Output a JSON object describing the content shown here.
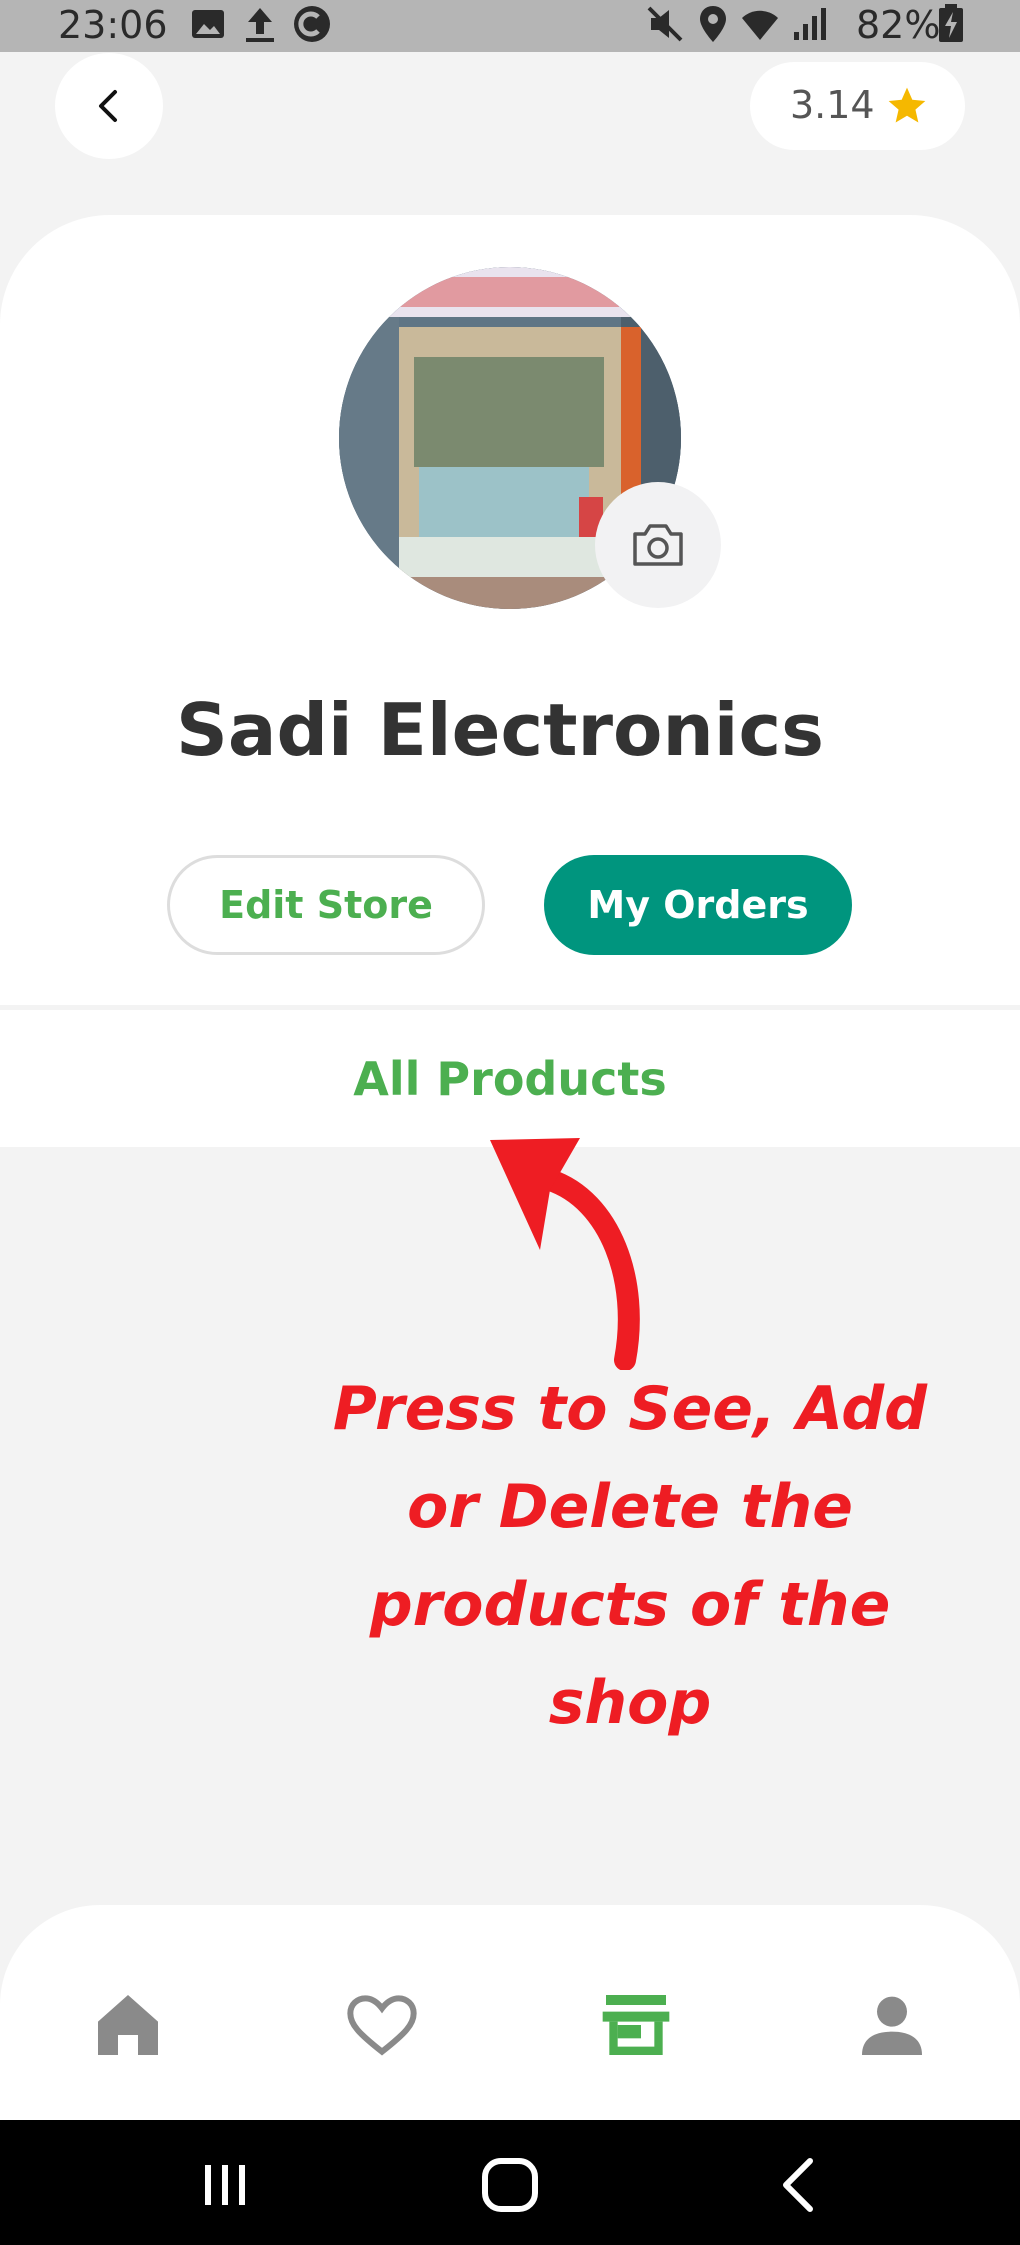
{
  "status_bar": {
    "time": "23:06",
    "battery": "82%",
    "icons": [
      "image-icon",
      "upload-icon",
      "c-app-icon",
      "mute-icon",
      "location-icon",
      "wifi-icon",
      "signal-icon",
      "battery-icon"
    ]
  },
  "header": {
    "back_icon": "chevron-left-icon",
    "rating": "3.14",
    "rating_icon": "star-icon",
    "star_color": "#f5b800"
  },
  "store": {
    "name": "Sadi Electronics",
    "photo_icon": "camera-icon",
    "edit_label": "Edit Store",
    "orders_label": "My Orders",
    "all_products_label": "All Products"
  },
  "annotation": {
    "lines": [
      "Press to See, Add",
      "or Delete the",
      "products of the",
      "shop"
    ],
    "color": "#ee1d23"
  },
  "bottom_nav": {
    "items": [
      "home-icon",
      "heart-icon",
      "store-icon",
      "person-icon"
    ],
    "active": "store-icon",
    "active_color": "#4caf50",
    "inactive_color": "#8a8a8a"
  },
  "colors": {
    "accent": "#00957e",
    "green_text": "#4caf50"
  }
}
